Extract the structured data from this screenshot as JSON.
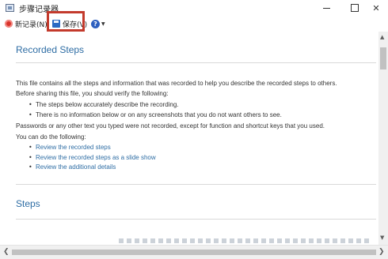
{
  "window": {
    "title": "步骤记录器",
    "minimize": "—",
    "close": "✕"
  },
  "toolbar": {
    "new_label": "新记录(N)",
    "save_label": "保存(V)",
    "help_glyph": "?",
    "help_caret": "▼"
  },
  "document": {
    "heading_recorded": "Recorded Steps",
    "intro": "This file contains all the steps and information that was recorded to help you describe the recorded steps to others.",
    "verify": "Before sharing this file, you should verify the following:",
    "bullets": [
      "The steps below accurately describe the recording.",
      "There is no information below or on any screenshots that you do not want others to see."
    ],
    "passwords": "Passwords or any other text you typed were not recorded, except for function and shortcut keys that you used.",
    "can_do": "You can do the following:",
    "links": [
      "Review the recorded steps",
      "Review the recorded steps as a slide show",
      "Review the additional details"
    ],
    "heading_steps": "Steps"
  },
  "scrollbars": {
    "up": "▲",
    "down": "▼",
    "left": "❮",
    "right": "❯"
  },
  "colors": {
    "link": "#2e6da4",
    "highlight_frame": "#c33a2c",
    "record_icon": "#d9342b"
  }
}
